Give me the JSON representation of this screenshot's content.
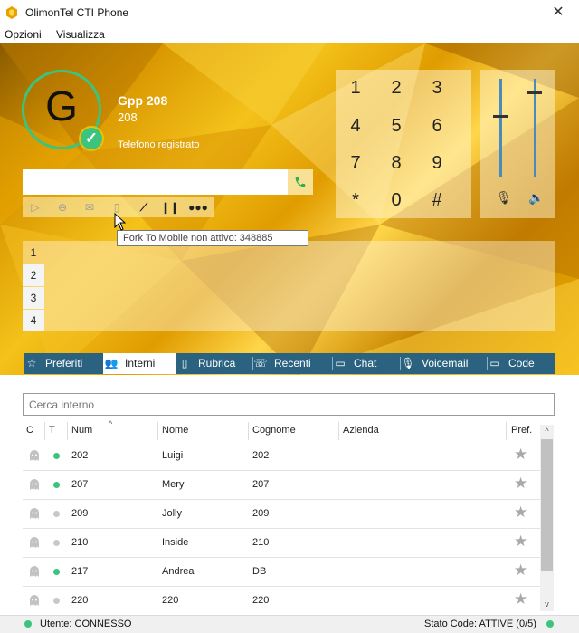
{
  "window": {
    "title": "OlimonTel CTI Phone",
    "close": "✕"
  },
  "menu": [
    "Opzioni",
    "Visualizza"
  ],
  "user": {
    "initial": "G",
    "name": "Gpp 208",
    "extension": "208",
    "registration_status": "Telefono registrato"
  },
  "dial": {
    "value": "",
    "placeholder": "",
    "call_icon": "phone-icon"
  },
  "actions": [
    "video-call-icon",
    "do-not-disturb-icon",
    "voicemail-envelope-icon",
    "mobile-phone-icon",
    "chart-icon",
    "hold-icon",
    "conference-icon"
  ],
  "tooltip": "Fork To Mobile non attivo: 348885",
  "keypad": [
    "1",
    "2",
    "3",
    "4",
    "5",
    "6",
    "7",
    "8",
    "9",
    "*",
    "0",
    "#"
  ],
  "volume": {
    "microphone_level": 0.63,
    "speaker_level": 0.87
  },
  "lines": [
    "1",
    "2",
    "3",
    "4"
  ],
  "tabs": [
    {
      "label": "Preferiti",
      "icon": "☆"
    },
    {
      "label": "Interni",
      "icon": "👥"
    },
    {
      "label": "Rubrica",
      "icon": "▯"
    },
    {
      "label": "Recenti",
      "icon": "☏"
    },
    {
      "label": "Chat",
      "icon": "▭"
    },
    {
      "label": "Voicemail",
      "icon": "🎙"
    },
    {
      "label": "Code",
      "icon": "▭"
    }
  ],
  "search": {
    "placeholder": "Cerca interno"
  },
  "table": {
    "columns": [
      "C",
      "T",
      "Num",
      "Nome",
      "Cognome",
      "Azienda",
      "Pref."
    ],
    "rows": [
      {
        "num": "202",
        "nome": "Luigi",
        "cognome": "202",
        "azienda": "",
        "online": true
      },
      {
        "num": "207",
        "nome": "Mery",
        "cognome": "207",
        "azienda": "",
        "online": true
      },
      {
        "num": "209",
        "nome": "Jolly",
        "cognome": "209",
        "azienda": "",
        "online": false
      },
      {
        "num": "210",
        "nome": "Inside",
        "cognome": "210",
        "azienda": "",
        "online": false
      },
      {
        "num": "217",
        "nome": "Andrea",
        "cognome": "DB",
        "azienda": "",
        "online": true
      },
      {
        "num": "220",
        "nome": "220",
        "cognome": "220",
        "azienda": "",
        "online": false
      }
    ]
  },
  "status": {
    "left": "Utente: CONNESSO",
    "right": "Stato Code: ATTIVE (0/5)"
  },
  "colors": {
    "accent_green": "#3cc47e",
    "tab_bar": "#2b627f",
    "banner_gold": "#f2b600",
    "offline_dot": "#c8c8c8"
  }
}
